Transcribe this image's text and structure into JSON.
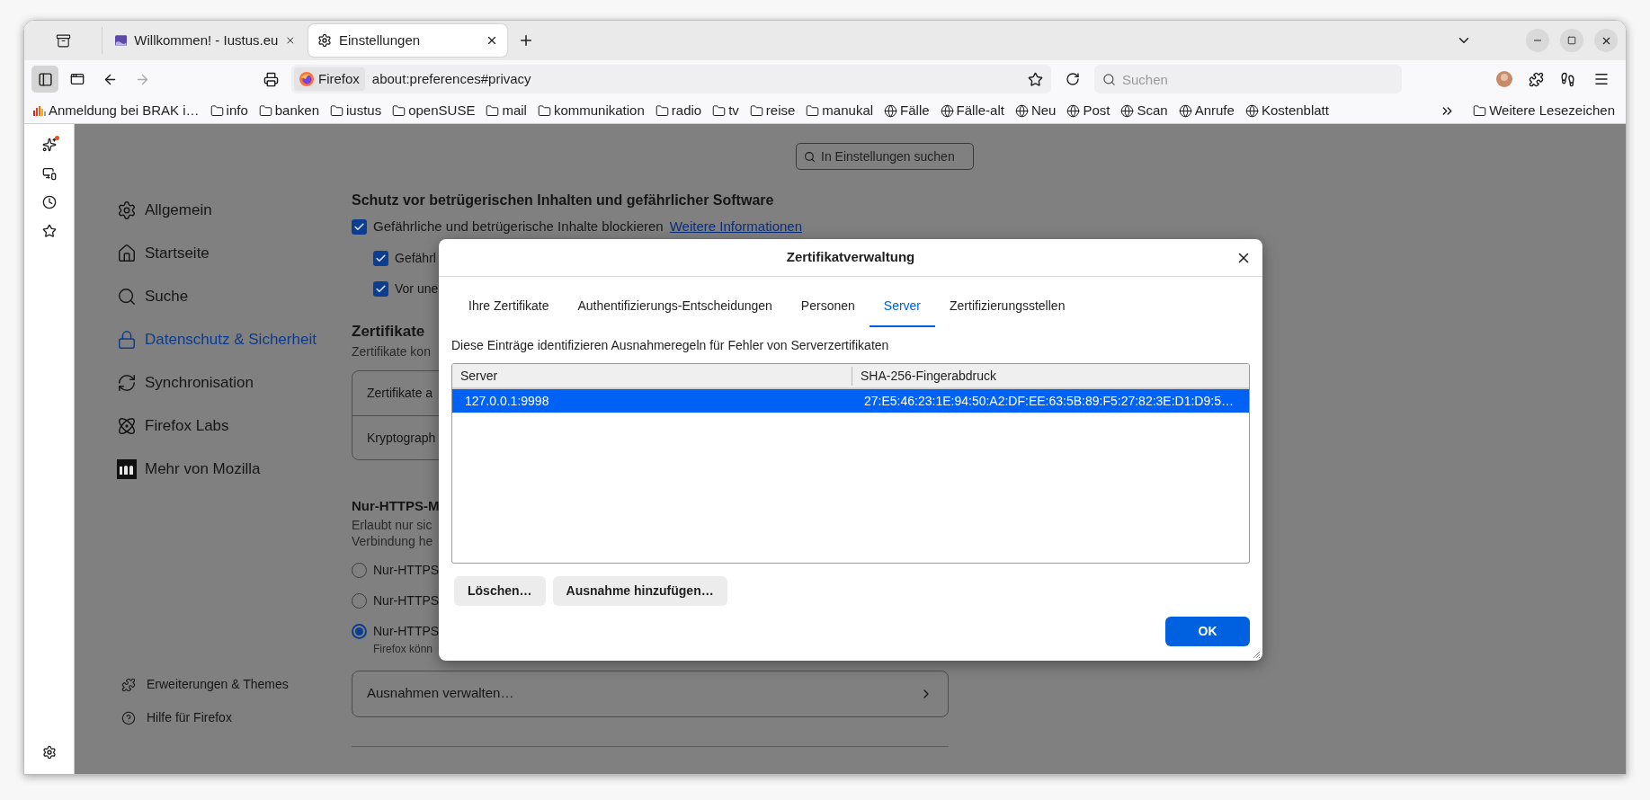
{
  "browser": {
    "tabs": [
      {
        "title": "Willkommen! - Iustus.eu",
        "selected": false
      },
      {
        "title": "Einstellungen",
        "selected": true
      }
    ],
    "sidebar_button": {
      "selected": true
    },
    "url": {
      "identity": "Firefox",
      "value": "about:preferences#privacy"
    },
    "search": {
      "placeholder": "Suchen"
    },
    "bookmarks": [
      {
        "label": "Anmeldung bei BRAK i…",
        "kind": "site"
      },
      {
        "label": "info",
        "kind": "folder"
      },
      {
        "label": "banken",
        "kind": "folder"
      },
      {
        "label": "iustus",
        "kind": "folder"
      },
      {
        "label": "openSUSE",
        "kind": "folder"
      },
      {
        "label": "mail",
        "kind": "folder"
      },
      {
        "label": "kommunikation",
        "kind": "folder"
      },
      {
        "label": "radio",
        "kind": "folder"
      },
      {
        "label": "tv",
        "kind": "folder"
      },
      {
        "label": "reise",
        "kind": "folder"
      },
      {
        "label": "manukal",
        "kind": "folder"
      },
      {
        "label": "Fälle",
        "kind": "globe"
      },
      {
        "label": "Fälle-alt",
        "kind": "globe"
      },
      {
        "label": "Neu",
        "kind": "globe"
      },
      {
        "label": "Post",
        "kind": "globe"
      },
      {
        "label": "Scan",
        "kind": "globe"
      },
      {
        "label": "Anrufe",
        "kind": "globe"
      },
      {
        "label": "Kostenblatt",
        "kind": "globe"
      }
    ],
    "other_bookmarks": {
      "label": "Weitere Lesezeichen"
    }
  },
  "settings": {
    "search": {
      "placeholder": "In Einstellungen suchen"
    },
    "nav": [
      {
        "label": "Allgemein",
        "selected": false
      },
      {
        "label": "Startseite",
        "selected": false
      },
      {
        "label": "Suche",
        "selected": false
      },
      {
        "label": "Datenschutz & Sicherheit",
        "selected": true
      },
      {
        "label": "Synchronisation",
        "selected": false
      },
      {
        "label": "Firefox Labs",
        "selected": false
      },
      {
        "label": "Mehr von Mozilla",
        "selected": false
      }
    ],
    "footer_nav": [
      "Erweiterungen & Themes",
      "Hilfe für Firefox"
    ],
    "content": {
      "heading": "Schutz vor betrügerischen Inhalten und gefährlicher Software",
      "block_checkbox": {
        "label": "Gefährliche und betrügerische Inhalte blockieren",
        "link": "Weitere Informationen",
        "checked": true
      },
      "sub_checkboxes": [
        {
          "label": "Gefährl",
          "checked": true
        },
        {
          "label": "Vor une",
          "checked": true
        }
      ],
      "certificates": {
        "title": "Zertifikate",
        "description": "Zertifikate kon",
        "rows": [
          "Zertifikate a",
          "Kryptograph"
        ]
      },
      "https_only": {
        "title": "Nur-HTTPS-M",
        "description": [
          "Erlaubt nur sic",
          "Verbindung he"
        ],
        "options": [
          {
            "label": "Nur-HTTPS",
            "selected": false
          },
          {
            "label": "Nur-HTTPS",
            "selected": false
          },
          {
            "label": "Nur-HTTPS",
            "selected": true,
            "note": "Firefox könn"
          }
        ]
      },
      "exceptions_button": "Ausnahmen verwalten…"
    }
  },
  "dialog": {
    "title": "Zertifikatverwaltung",
    "tabs": [
      {
        "label": "Ihre Zertifikate",
        "selected": false
      },
      {
        "label": "Authentifizierungs-Entscheidungen",
        "selected": false
      },
      {
        "label": "Personen",
        "selected": false
      },
      {
        "label": "Server",
        "selected": true
      },
      {
        "label": "Zertifizierungsstellen",
        "selected": false
      }
    ],
    "description": "Diese Einträge identifizieren Ausnahmeregeln für Fehler von Serverzertifikaten",
    "table": {
      "columns": [
        "Server",
        "SHA-256-Fingerabdruck"
      ],
      "rows": [
        {
          "cells": [
            "127.0.0.1:9998",
            "27:E5:46:23:1E:94:50:A2:DF:EE:63:5B:89:F5:27:82:3E:D1:D9:5…"
          ],
          "selected": true
        }
      ]
    },
    "buttons": [
      "Löschen…",
      "Ausnahme hinzufügen…"
    ],
    "ok": "OK"
  }
}
